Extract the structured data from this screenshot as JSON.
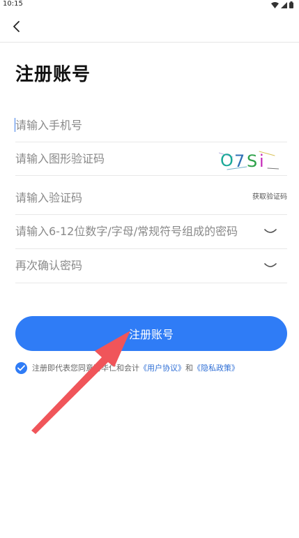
{
  "status_bar": {
    "time": "10:15"
  },
  "page": {
    "title": "注册账号"
  },
  "form": {
    "phone_placeholder": "请输入手机号",
    "image_captcha_placeholder": "请输入图形验证码",
    "captcha_text": "O7Si",
    "sms_code_placeholder": "请输入验证码",
    "get_code_label": "获取验证码",
    "password_placeholder": "请输入6-12位数字/字母/常规符号组成的密码",
    "confirm_password_placeholder": "再次确认密码"
  },
  "submit": {
    "label": "注册账号"
  },
  "agreement": {
    "checked": true,
    "prefix": "注册即代表您同意财华仁和会计",
    "user_agreement": "《用户协议》",
    "and": "和",
    "privacy_policy": "《隐私政策》"
  },
  "colors": {
    "accent": "#2f7cf6",
    "annotation_arrow": "#f0555a"
  }
}
